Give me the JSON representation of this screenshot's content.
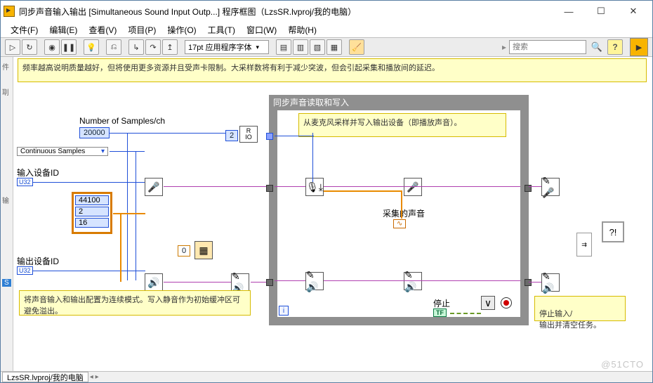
{
  "window": {
    "title": "同步声音输入输出 [Simultaneous Sound Input Outp...] 程序框图（LzsSR.lvproj/我的电脑）",
    "min": "—",
    "max": "☐",
    "close": "✕"
  },
  "menu": {
    "file": "文件(F)",
    "edit": "编辑(E)",
    "view": "查看(V)",
    "project": "项目(P)",
    "operate": "操作(O)",
    "tools": "工具(T)",
    "window": "窗口(W)",
    "help": "帮助(H)"
  },
  "toolbar": {
    "font": "17pt 应用程序字体",
    "search_placeholder": "搜索",
    "help": "?"
  },
  "diagram": {
    "topnote": "频率越高说明质量越好，但将使用更多资源并且受声卡限制。大采样数将有利于减少突波，但会引起采集和播放间的延迟。",
    "samples_label": "Number of Samples/ch",
    "samples_value": "20000",
    "sample_mode": "Continuous Samples",
    "input_dev_label": "输入设备ID",
    "output_dev_label": "输出设备ID",
    "u32": "U32",
    "format": {
      "rate": "44100",
      "chan": "2",
      "bits": "16"
    },
    "const2": "2",
    "const0": "0",
    "rio": "R\nIO",
    "note_setup": "将声音输入和输出配置为连续模式。写入静音作为初始缓冲区可避免溢出。",
    "loop_title": "同步声音读取和写入",
    "note_loop": "从麦克风采样并写入输出设备（即播放声音）。",
    "captured_label": "采集的声音",
    "stop_label": "停止",
    "tf": "TF",
    "iterm": "i",
    "note_end": "停止输入/\n输出并清空任务。",
    "error": "?!"
  },
  "tabs": {
    "path": "LzsSR.lvproj/我的电脑"
  },
  "leftband": {
    "a": "件",
    "b": "刵",
    "c": "输",
    "d": "S"
  },
  "watermark": "@51CTO"
}
